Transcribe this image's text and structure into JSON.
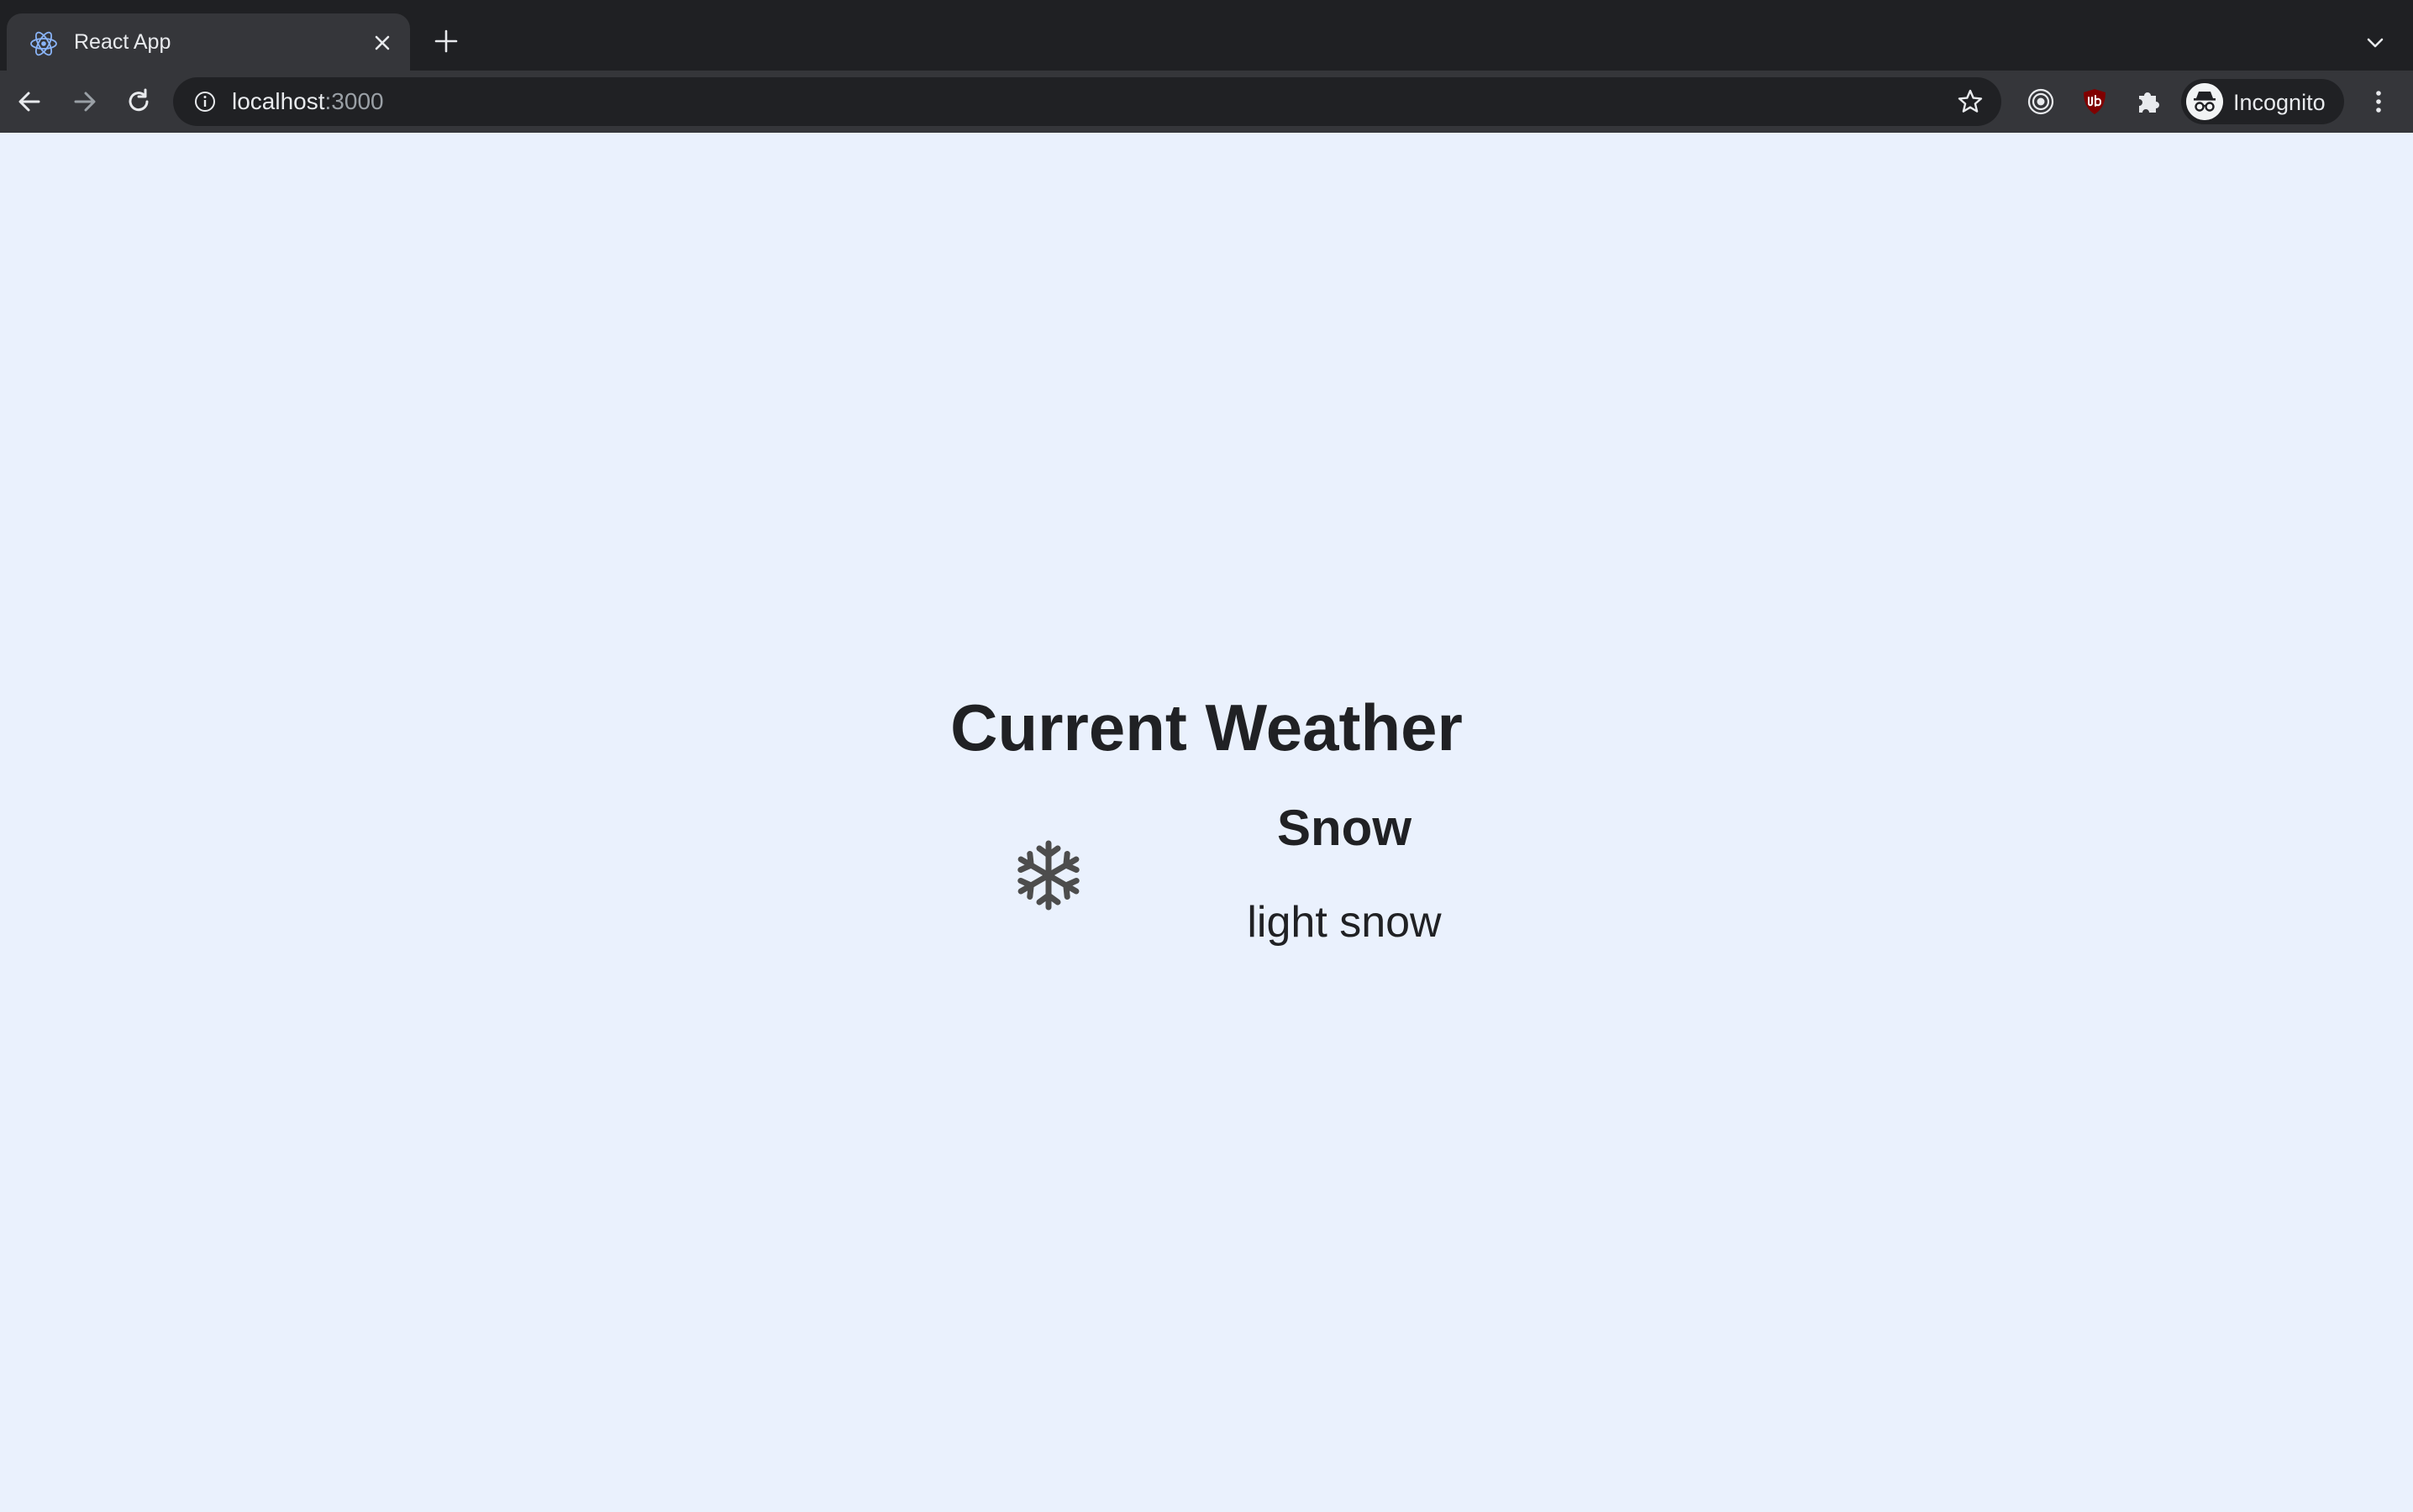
{
  "browser": {
    "tab": {
      "title": "React App",
      "favicon": "react-logo-icon"
    },
    "address_bar": {
      "host": "localhost",
      "port": ":3000"
    },
    "profile": {
      "label": "Incognito"
    },
    "icons": {
      "back": "arrow-left-icon",
      "forward": "arrow-right-icon",
      "reload": "reload-icon",
      "info": "info-icon",
      "bookmark": "star-icon",
      "extensions": [
        "target-extension-icon",
        "ublock-icon",
        "puzzle-icon"
      ],
      "menu": "kebab-menu-icon",
      "new_tab": "plus-icon",
      "tab_search": "chevron-down-icon"
    },
    "colors": {
      "frame": "#202124",
      "toolbar": "#35363a",
      "text": "#e8eaed",
      "muted": "#9aa0a6"
    }
  },
  "page": {
    "background": "#eaf1fd",
    "title": "Current Weather",
    "weather": {
      "icon": "snowflake-icon",
      "main": "Snow",
      "description": "light snow"
    }
  }
}
